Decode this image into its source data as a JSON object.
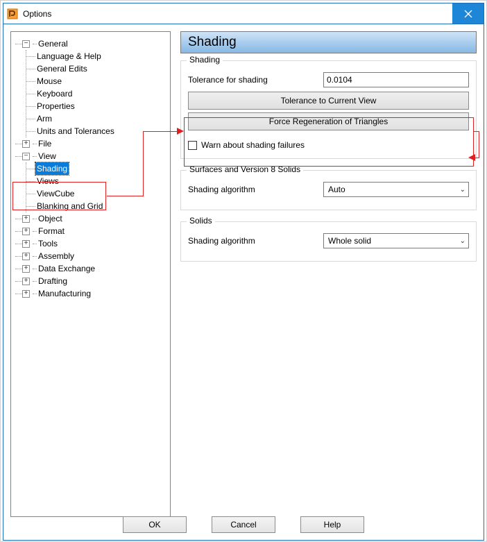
{
  "window": {
    "title": "Options"
  },
  "tree": {
    "general": {
      "label": "General",
      "children": [
        "Language & Help",
        "General Edits",
        "Mouse",
        "Keyboard",
        "Properties",
        "Arm",
        "Units and Tolerances"
      ]
    },
    "file": {
      "label": "File"
    },
    "view": {
      "label": "View",
      "children": [
        "Shading",
        "Views",
        "ViewCube",
        "Blanking and Grid"
      ]
    },
    "object": {
      "label": "Object"
    },
    "format": {
      "label": "Format"
    },
    "tools": {
      "label": "Tools"
    },
    "assembly": {
      "label": "Assembly"
    },
    "data_exchange": {
      "label": "Data Exchange"
    },
    "drafting": {
      "label": "Drafting"
    },
    "manufacturing": {
      "label": "Manufacturing"
    }
  },
  "page": {
    "title": "Shading",
    "shading_group": {
      "legend": "Shading",
      "tolerance_label": "Tolerance for shading",
      "tolerance_value": "0.0104",
      "btn_tolerance_view": "Tolerance to Current View",
      "btn_force_regen": "Force Regeneration of Triangles",
      "warn_label": "Warn about shading failures"
    },
    "surfaces_group": {
      "legend": "Surfaces and Version 8 Solids",
      "algo_label": "Shading algorithm",
      "algo_value": "Auto"
    },
    "solids_group": {
      "legend": "Solids",
      "algo_label": "Shading algorithm",
      "algo_value": "Whole solid"
    }
  },
  "footer": {
    "ok": "OK",
    "cancel": "Cancel",
    "help": "Help"
  }
}
